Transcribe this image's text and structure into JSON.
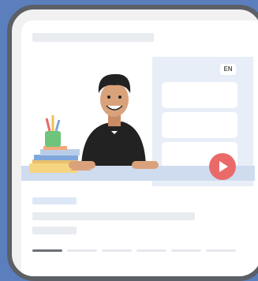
{
  "video": {
    "language_badge": "EN"
  },
  "colors": {
    "background": "#5b7fbd",
    "device_frame": "#5c5f66",
    "accent_play": "#ea6a6a",
    "side_panel": "#e8eef7"
  },
  "icons": {
    "play": "play-icon",
    "person": "presenter-illustration",
    "books": "books-illustration",
    "pencil_cup": "pencil-cup-illustration"
  },
  "carousel": {
    "active_index": 0,
    "segment_count": 6
  }
}
